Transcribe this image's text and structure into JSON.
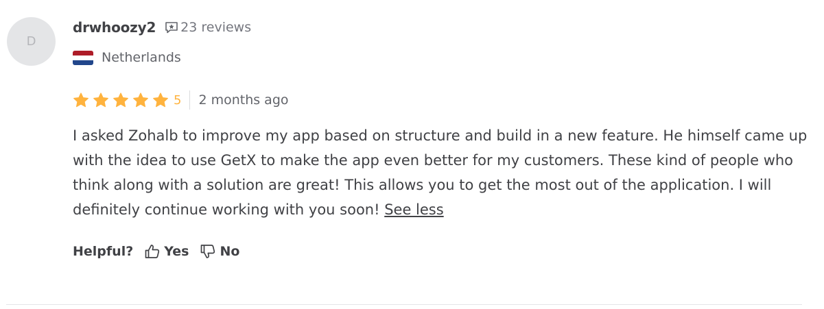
{
  "review": {
    "avatar_initial": "D",
    "username": "drwhoozy2",
    "review_count": "23 reviews",
    "country": "Netherlands",
    "flag_colors": [
      "#ae1c28",
      "#ffffff",
      "#21468b"
    ],
    "rating": 5,
    "rating_label": "5",
    "star_color": "#ffb33e",
    "time_ago": "2 months ago",
    "text": "I asked Zohalb to improve my app based on structure and build in a new feature. He himself came up with the idea to use GetX to make the app even better for my customers. These kind of people who think along with a solution are great! This allows you to get the most out of the application. I will definitely continue working with you soon! ",
    "see_less_label": "See less"
  },
  "helpful": {
    "label": "Helpful?",
    "yes_label": "Yes",
    "no_label": "No"
  },
  "icons": [
    "review-count-icon",
    "star-icon",
    "thumbs-up-icon",
    "thumbs-down-icon"
  ]
}
